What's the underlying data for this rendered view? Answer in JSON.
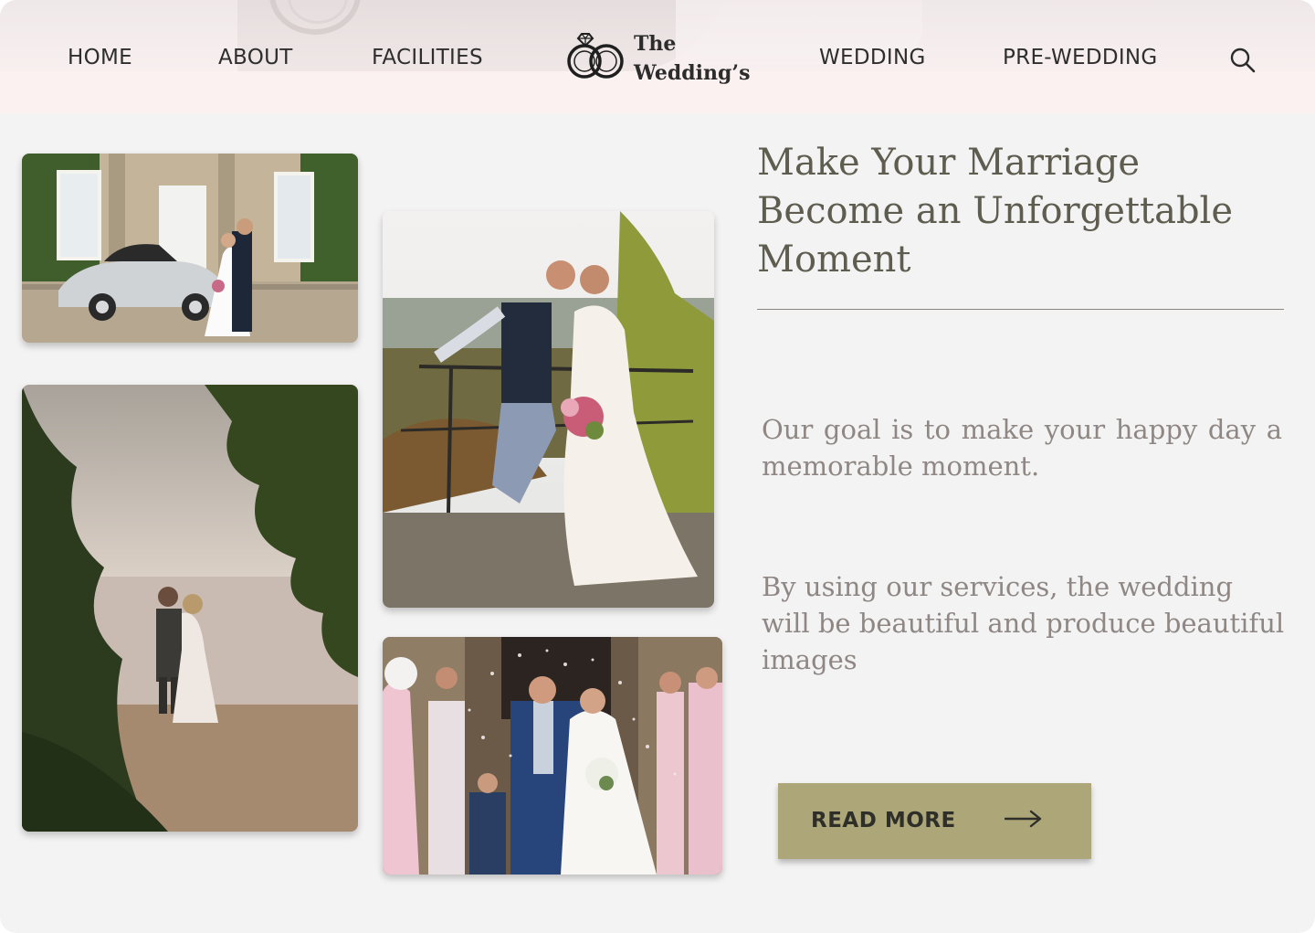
{
  "nav": {
    "home": "HOME",
    "about": "ABOUT",
    "facilities": "FACILITIES",
    "wedding": "WEDDING",
    "pre_wedding": "PRE-WEDDING"
  },
  "logo": {
    "line1": "The",
    "line2": "Wedding’s",
    "icon": "wedding-rings-icon"
  },
  "search_icon": "search-icon",
  "hero": {
    "headline_line1": "Make Your Marriage",
    "headline_line2": "Become an Unforgettable",
    "headline_line3": "Moment",
    "paragraph1": "Our goal is to make your happy day a memorable moment.",
    "paragraph2": "By using our services, the wedding will be beautiful and produce beautiful images",
    "button_label": "READ MORE",
    "button_icon": "arrow-right-icon"
  },
  "colors": {
    "accent": "#aca678",
    "headline": "#5e5d50",
    "body_text": "#8e8784",
    "background": "#f4f3f3",
    "header_band": "#fcf1f1"
  }
}
